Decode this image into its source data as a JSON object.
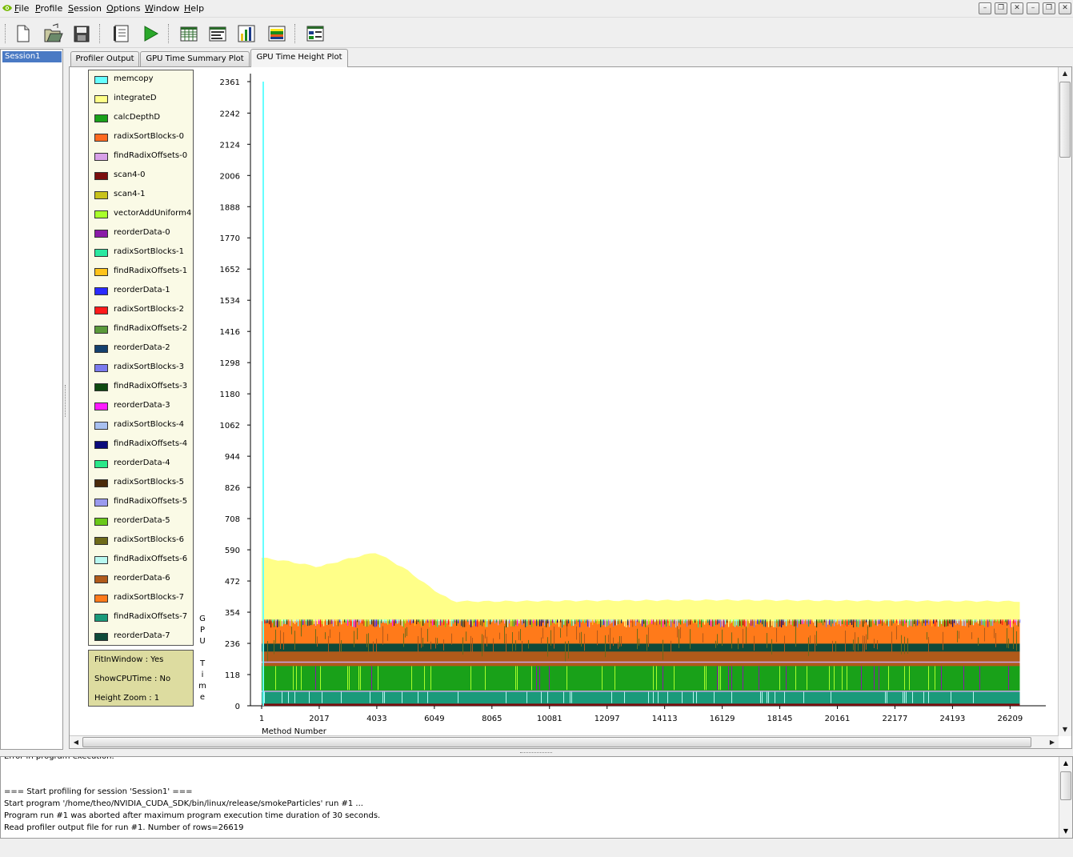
{
  "menubar": {
    "items": [
      {
        "id": "file",
        "label": "File",
        "mnemonic": "F"
      },
      {
        "id": "profile",
        "label": "Profile",
        "mnemonic": "P"
      },
      {
        "id": "session",
        "label": "Session",
        "mnemonic": "S"
      },
      {
        "id": "options",
        "label": "Options",
        "mnemonic": "O"
      },
      {
        "id": "window",
        "label": "Window",
        "mnemonic": "W"
      },
      {
        "id": "help",
        "label": "Help",
        "mnemonic": "H"
      }
    ]
  },
  "window_controls": [
    "minimize-icon",
    "restore-icon",
    "close-icon",
    "minimize-icon",
    "restore-icon",
    "close-icon"
  ],
  "toolbar": {
    "buttons": [
      "new-session-icon",
      "open-session-icon",
      "save-session-icon",
      "session-settings-icon",
      "start-profiling-icon",
      "table-view-icon",
      "summary-table-icon",
      "summary-plot-icon",
      "height-plot-icon",
      "device-info-icon"
    ]
  },
  "session_tree": {
    "items": [
      {
        "label": "Session1",
        "selected": true
      }
    ]
  },
  "tabs": [
    {
      "label": "Profiler Output",
      "active": false
    },
    {
      "label": "GPU Time Summary Plot",
      "active": false
    },
    {
      "label": "GPU Time Height Plot",
      "active": true
    }
  ],
  "legend": [
    {
      "label": "memcopy",
      "color": "#66ffff"
    },
    {
      "label": "integrateD",
      "color": "#ffff88"
    },
    {
      "label": "calcDepthD",
      "color": "#19a119"
    },
    {
      "label": "radixSortBlocks-0",
      "color": "#ff6a1f"
    },
    {
      "label": "findRadixOffsets-0",
      "color": "#d8a0e8"
    },
    {
      "label": "scan4-0",
      "color": "#7a0d0d"
    },
    {
      "label": "scan4-1",
      "color": "#c8c21a"
    },
    {
      "label": "vectorAddUniform4",
      "color": "#a8ff2a"
    },
    {
      "label": "reorderData-0",
      "color": "#8a1aa8"
    },
    {
      "label": "radixSortBlocks-1",
      "color": "#2ae8a0"
    },
    {
      "label": "findRadixOffsets-1",
      "color": "#ffc31a"
    },
    {
      "label": "reorderData-1",
      "color": "#2a2aff"
    },
    {
      "label": "radixSortBlocks-2",
      "color": "#ff1a1a"
    },
    {
      "label": "findRadixOffsets-2",
      "color": "#5a9a3a"
    },
    {
      "label": "reorderData-2",
      "color": "#14406e"
    },
    {
      "label": "radixSortBlocks-3",
      "color": "#7a7aee"
    },
    {
      "label": "findRadixOffsets-3",
      "color": "#0e4a10"
    },
    {
      "label": "reorderData-3",
      "color": "#ff1aff"
    },
    {
      "label": "radixSortBlocks-4",
      "color": "#a8c0f0"
    },
    {
      "label": "findRadixOffsets-4",
      "color": "#0a0a7a"
    },
    {
      "label": "reorderData-4",
      "color": "#2ae88a"
    },
    {
      "label": "radixSortBlocks-5",
      "color": "#4a2a0a"
    },
    {
      "label": "findRadixOffsets-5",
      "color": "#9a9aee"
    },
    {
      "label": "reorderData-5",
      "color": "#6ac81a"
    },
    {
      "label": "radixSortBlocks-6",
      "color": "#6e6a1a"
    },
    {
      "label": "findRadixOffsets-6",
      "color": "#b8f8f0"
    },
    {
      "label": "reorderData-6",
      "color": "#b05a1a"
    },
    {
      "label": "radixSortBlocks-7",
      "color": "#ff7a1a"
    },
    {
      "label": "findRadixOffsets-7",
      "color": "#1a9a7a"
    },
    {
      "label": "reorderData-7",
      "color": "#0e4a3a"
    }
  ],
  "settings": {
    "fit_in_window": "FitInWindow : Yes",
    "show_cpu_time": "ShowCPUTime : No",
    "height_zoom": "Height Zoom : 1"
  },
  "chart_data": {
    "type": "area",
    "title": "",
    "xlabel": "Method Number",
    "ylabel": "GPU Time",
    "xlim": [
      1,
      26619
    ],
    "ylim": [
      0,
      2361
    ],
    "x_ticks": [
      "1",
      "2017",
      "4033",
      "6049",
      "8065",
      "10081",
      "12097",
      "14113",
      "16129",
      "18145",
      "20161",
      "22177",
      "24193",
      "26209"
    ],
    "y_ticks": [
      "0",
      "118",
      "236",
      "354",
      "472",
      "590",
      "708",
      "826",
      "944",
      "1062",
      "1180",
      "1298",
      "1416",
      "1534",
      "1652",
      "1770",
      "1888",
      "2006",
      "2124",
      "2242",
      "2361"
    ],
    "series": [
      {
        "name": "memcopy",
        "color": "#66ffff",
        "description": "spike at method 1",
        "x": [
          1
        ],
        "y": [
          2361
        ]
      },
      {
        "name": "integrateD",
        "color": "#ffff88",
        "x": [
          1,
          1000,
          2000,
          3000,
          4000,
          5000,
          6000,
          6700,
          8000,
          12000,
          16000,
          20000,
          24000,
          26619
        ],
        "y": [
          560,
          545,
          525,
          555,
          580,
          520,
          440,
          395,
          395,
          398,
          400,
          398,
          396,
          395
        ]
      },
      {
        "name": "radixSortBlocks-7",
        "color": "#ff7a1a",
        "x": [
          1,
          26619
        ],
        "y": [
          320,
          320
        ]
      },
      {
        "name": "reorderData-6",
        "color": "#b05a1a",
        "x": [
          1,
          26619
        ],
        "y": [
          205,
          205
        ]
      },
      {
        "name": "reorderData-7",
        "color": "#0e4a3a",
        "x": [
          1,
          26619
        ],
        "y": [
          235,
          235
        ]
      },
      {
        "name": "calcDepthD",
        "color": "#19a119",
        "x": [
          1,
          26619
        ],
        "y": [
          150,
          150
        ]
      },
      {
        "name": "findRadixOffsets-7",
        "color": "#1a9a7a",
        "x": [
          1,
          26619
        ],
        "y": [
          55,
          55
        ]
      },
      {
        "name": "scan4-0",
        "color": "#7a0d0d",
        "x": [
          1,
          26619
        ],
        "y": [
          8,
          8
        ]
      }
    ]
  },
  "log": {
    "lines": [
      "Error in program execution.",
      "",
      "",
      "=== Start profiling for session 'Session1' ===",
      "Start program '/home/theo/NVIDIA_CUDA_SDK/bin/linux/release/smokeParticles' run #1 ...",
      "Program run #1 was aborted after maximum program execution time duration of 30 seconds.",
      "Read profiler output file for run #1. Number of rows=26619"
    ]
  },
  "ylabel_letters": [
    "G",
    "P",
    "U",
    "",
    "T",
    "i",
    "m",
    "e"
  ]
}
